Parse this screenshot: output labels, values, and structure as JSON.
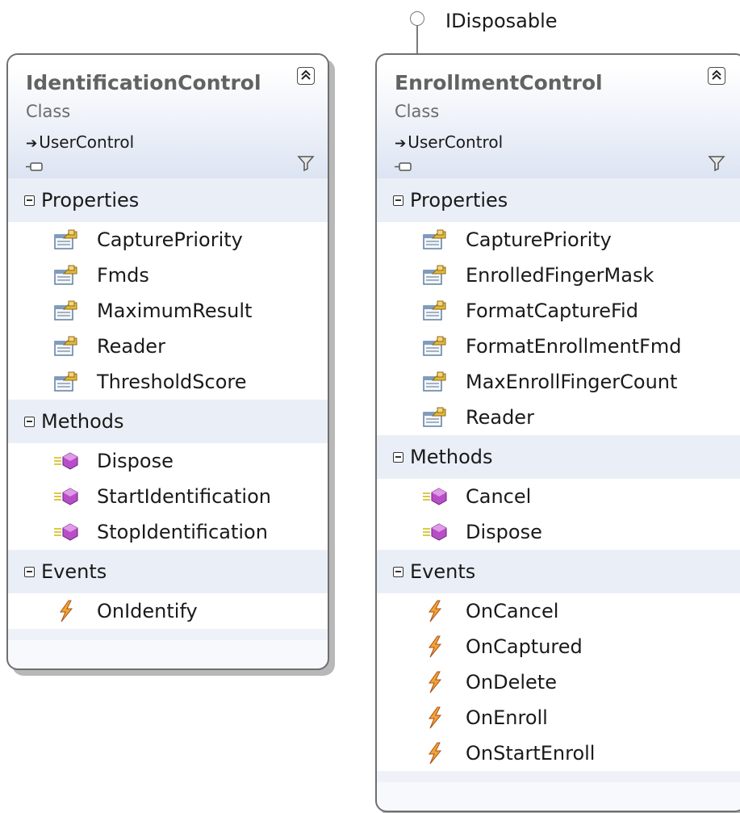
{
  "interface_lollipop": {
    "label": "IDisposable"
  },
  "identification": {
    "name": "IdentificationControl",
    "kind": "Class",
    "base": "UserControl",
    "sections": [
      {
        "title": "Properties",
        "icon": "property-icon",
        "items": [
          "CapturePriority",
          "Fmds",
          "MaximumResult",
          "Reader",
          "ThresholdScore"
        ]
      },
      {
        "title": "Methods",
        "icon": "method-icon",
        "items": [
          "Dispose",
          "StartIdentification",
          "StopIdentification"
        ]
      },
      {
        "title": "Events",
        "icon": "event-icon",
        "items": [
          "OnIdentify"
        ]
      }
    ]
  },
  "enrollment": {
    "name": "EnrollmentControl",
    "kind": "Class",
    "base": "UserControl",
    "sections": [
      {
        "title": "Properties",
        "icon": "property-icon",
        "items": [
          "CapturePriority",
          "EnrolledFingerMask",
          "FormatCaptureFid",
          "FormatEnrollmentFmd",
          "MaxEnrollFingerCount",
          "Reader"
        ]
      },
      {
        "title": "Methods",
        "icon": "method-icon",
        "items": [
          "Cancel",
          "Dispose"
        ]
      },
      {
        "title": "Events",
        "icon": "event-icon",
        "items": [
          "OnCancel",
          "OnCaptured",
          "OnDelete",
          "OnEnroll",
          "OnStartEnroll"
        ]
      }
    ]
  }
}
